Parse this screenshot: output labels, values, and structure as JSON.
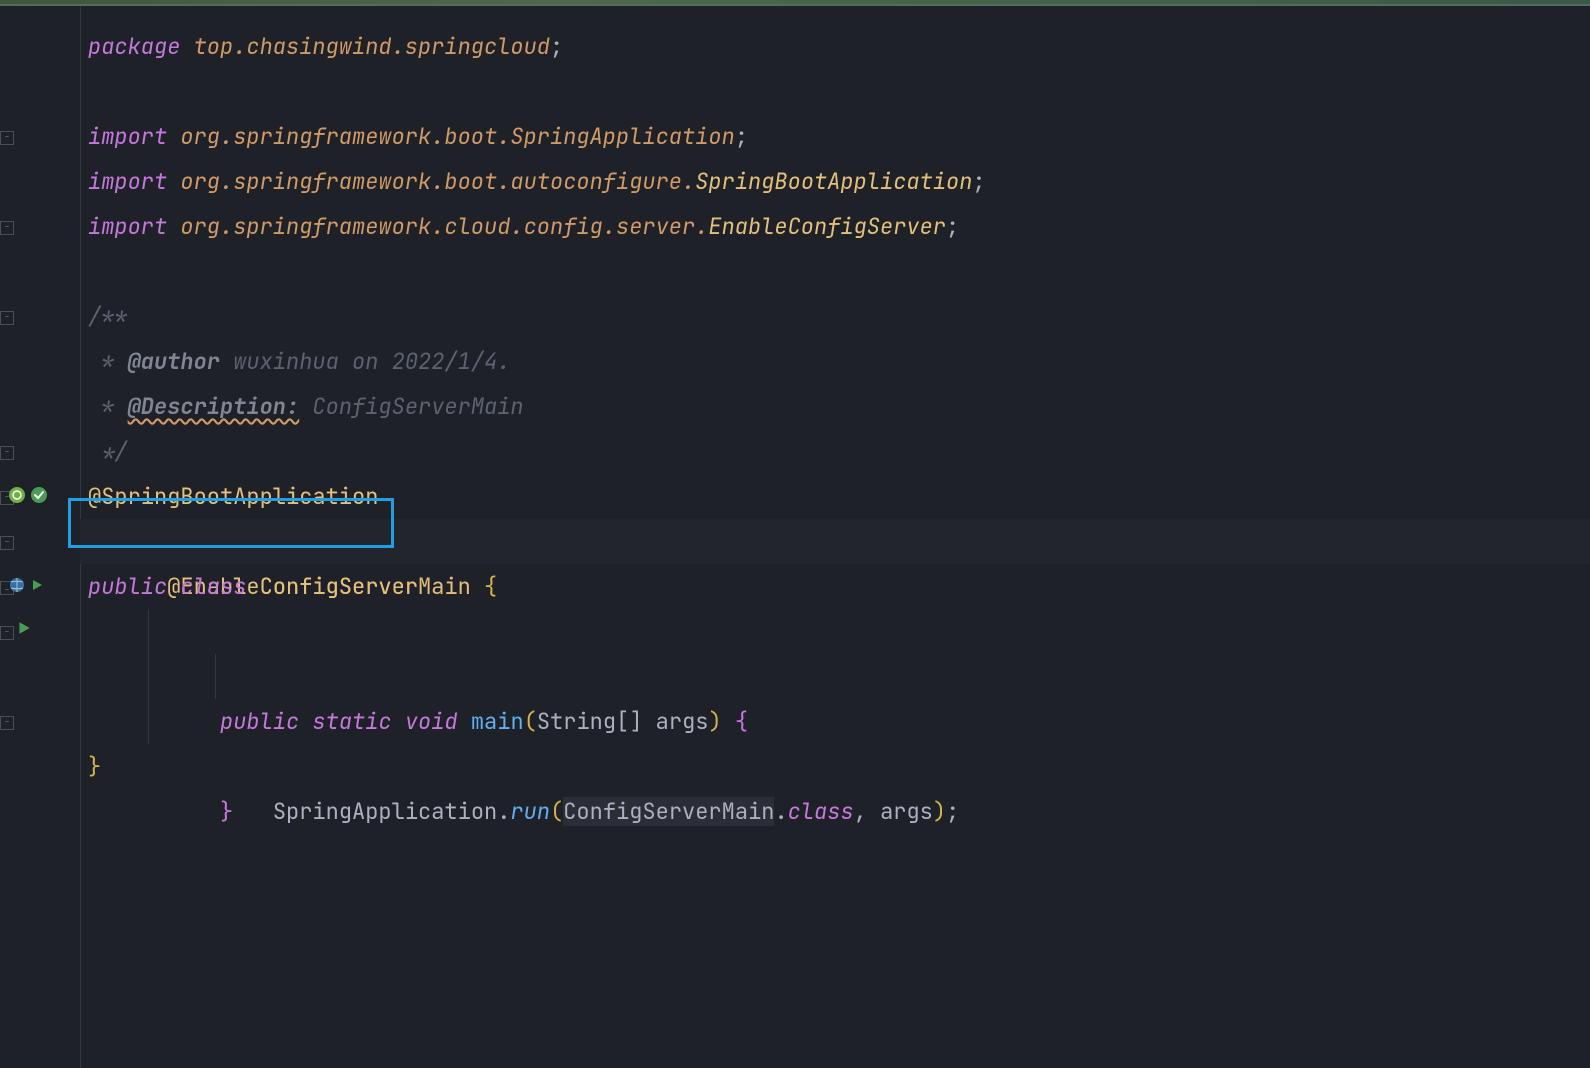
{
  "code": {
    "line1": {
      "kw": "package",
      "rest": " top.chasingwind.springcloud",
      "semi": ";"
    },
    "line3": {
      "kw": "import",
      "rest": " org.springframework.boot.",
      "cls": "SpringApplication",
      "semi": ";"
    },
    "line4": {
      "kw": "import",
      "rest": " org.springframework.boot.autoconfigure.",
      "cls": "SpringBootApplication",
      "semi": ";"
    },
    "line5": {
      "kw": "import",
      "rest": " org.springframework.cloud.config.server.",
      "cls": "EnableConfigServer",
      "semi": ";"
    },
    "line7": {
      "open": "/**"
    },
    "line8": {
      "star": " * ",
      "tag": "@author",
      "rest": " wuxinhua on 2022/1/4."
    },
    "line9": {
      "star": " * ",
      "tag": "@Description:",
      "rest": " ConfigServerMain"
    },
    "line10": {
      "close": " */"
    },
    "line11": {
      "ann": "@SpringBootApplication"
    },
    "line12": {
      "ann": "@EnableConfigServer"
    },
    "line13": {
      "kw1": "public",
      "kw2": "class",
      "name": "ConfigServerMain",
      "brace": " {"
    },
    "line14": {
      "indent": "    ",
      "kw1": "public",
      "kw2": "static",
      "kw3": "void",
      "method": "main",
      "paren1": "(",
      "type": "String",
      "arr": "[] ",
      "param": "args",
      "paren2": ")",
      "brace": " {"
    },
    "line15": {
      "indent": "        ",
      "cls": "SpringApplication",
      "dot": ".",
      "method": "run",
      "paren1": "(",
      "arg1": "ConfigServerMain",
      "dot2": ".",
      "classlit": "class",
      "comma": ", ",
      "arg2": "args",
      "paren2": ")",
      "semi": ";"
    },
    "line16": {
      "indent": "    ",
      "brace": "}"
    },
    "line17": {
      "brace": "}"
    }
  },
  "gutter": {
    "spring_icon": "spring-bean-icon",
    "check_icon": "check-icon",
    "run_icon": "run-icon",
    "globe_icon": "globe-icon"
  }
}
